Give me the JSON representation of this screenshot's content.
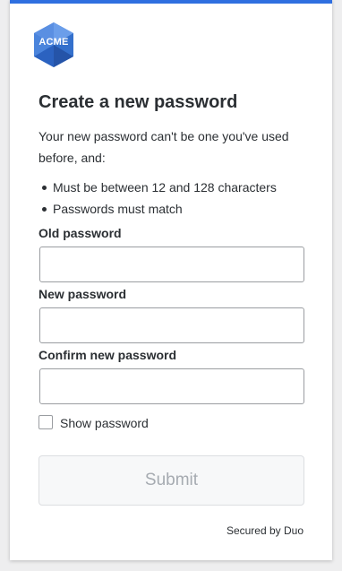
{
  "brand": {
    "logo_text": "ACME",
    "accent_color": "#2f6fe0",
    "logo_colors": [
      "#3b78d8",
      "#5a93e6",
      "#2b5fb8"
    ]
  },
  "page": {
    "title": "Create a new password",
    "intro": "Your new password can't be one you've used before, and:",
    "rules": [
      "Must be between 12 and 128 characters",
      "Passwords must match"
    ]
  },
  "form": {
    "old_password": {
      "label": "Old password",
      "value": "",
      "placeholder": ""
    },
    "new_password": {
      "label": "New password",
      "value": "",
      "placeholder": ""
    },
    "confirm_password": {
      "label": "Confirm new password",
      "value": "",
      "placeholder": ""
    },
    "show_password": {
      "label": "Show password",
      "checked": false
    },
    "submit_label": "Submit"
  },
  "footer": {
    "secured_by": "Secured by Duo"
  }
}
